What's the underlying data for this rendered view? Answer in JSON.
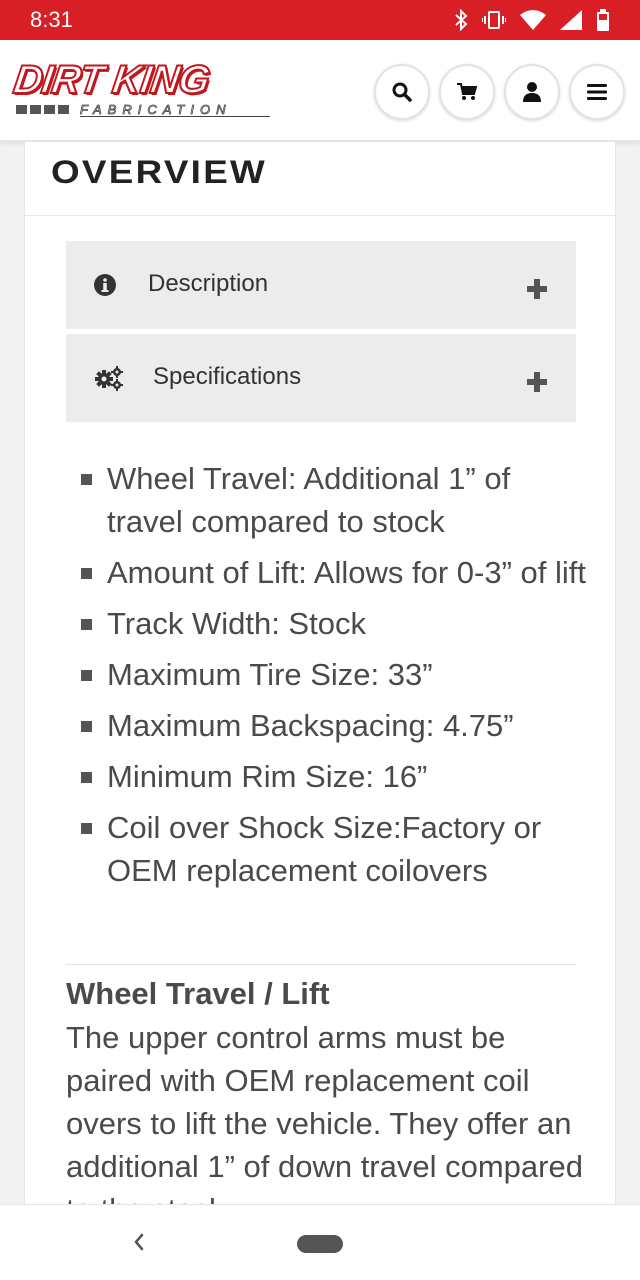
{
  "status_bar": {
    "time": "8:31",
    "icons": [
      "bluetooth-icon",
      "vibrate-icon",
      "wifi-icon",
      "signal-icon",
      "battery-icon"
    ],
    "color": "#d81f26"
  },
  "header": {
    "logo_text": "DIRT KING",
    "logo_subtext": "FABRICATION",
    "buttons": [
      "search-icon",
      "cart-icon",
      "user-icon",
      "menu-icon"
    ]
  },
  "overview": {
    "title": "OVERVIEW",
    "accordions": [
      {
        "label": "Description",
        "icon": "info-icon"
      },
      {
        "label": "Specifications",
        "icon": "gears-icon"
      }
    ],
    "specs": [
      "Wheel Travel: Additional 1” of travel compared to stock",
      "Amount of Lift: Allows for 0-3” of lift",
      "Track Width: Stock",
      "Maximum Tire Size: 33”",
      "Maximum Backspacing: 4.75”",
      "Minimum Rim Size: 16”",
      "Coil over Shock Size:Factory or OEM replacement coilovers"
    ],
    "section_heading": "Wheel Travel / Lift",
    "section_body": "The upper control arms must be paired with OEM replacement coil overs to lift the vehicle. They offer an additional 1” of down travel compared to the stock"
  },
  "nav_bar": {
    "back_icon": "back-chevron-icon",
    "home_icon": "home-pill-icon"
  }
}
